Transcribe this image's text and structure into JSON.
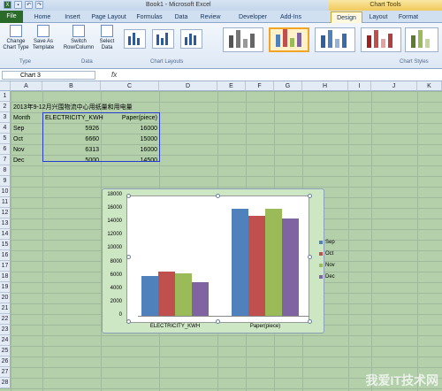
{
  "window": {
    "title": "Book1 - Microsoft Excel",
    "context_tab": "Chart Tools"
  },
  "tabs": [
    "File",
    "Home",
    "Insert",
    "Page Layout",
    "Formulas",
    "Data",
    "Review",
    "Developer",
    "Add-Ins",
    "Design",
    "Layout",
    "Format"
  ],
  "ribbon": {
    "change_chart_type": "Change\nChart Type",
    "save_as_template": "Save As\nTemplate",
    "switch_row_column": "Switch\nRow/Column",
    "select_data": "Select\nData",
    "group_type": "Type",
    "group_data": "Data",
    "group_layouts": "Chart Layouts",
    "group_styles": "Chart Styles"
  },
  "formula_bar": {
    "name_box": "Chart 3",
    "fx": "fx"
  },
  "columns": [
    "A",
    "B",
    "C",
    "D",
    "E",
    "F",
    "G",
    "H",
    "I",
    "J",
    "K"
  ],
  "rows": [
    "1",
    "2",
    "3",
    "4",
    "5",
    "6",
    "7",
    "8",
    "9",
    "10",
    "11",
    "12",
    "13",
    "14",
    "15",
    "16",
    "17",
    "18",
    "19",
    "20",
    "21",
    "22",
    "23",
    "24",
    "25",
    "26",
    "27",
    "28"
  ],
  "sheet": {
    "title": "2013年9-12月兴围物流中心用纸量和用电量",
    "headers": [
      "Month",
      "ELECTRICITY_KWH",
      "Paper(piece)"
    ],
    "data": [
      [
        "Sep",
        "5926",
        "16000"
      ],
      [
        "Oct",
        "6660",
        "15000"
      ],
      [
        "Nov",
        "6313",
        "16000"
      ],
      [
        "Dec",
        "5000",
        "14500"
      ]
    ]
  },
  "chart_data": {
    "type": "bar",
    "categories": [
      "ELECTRICITY_KWH",
      "Paper(piece)"
    ],
    "series": [
      {
        "name": "Sep",
        "values": [
          5926,
          16000
        ],
        "color": "#4f81bd"
      },
      {
        "name": "Oct",
        "values": [
          6660,
          15000
        ],
        "color": "#c0504d"
      },
      {
        "name": "Nov",
        "values": [
          6313,
          16000
        ],
        "color": "#9bbb59"
      },
      {
        "name": "Dec",
        "values": [
          5000,
          14500
        ],
        "color": "#8064a2"
      }
    ],
    "ylim": [
      0,
      18000
    ],
    "yticks": [
      "18000",
      "16000",
      "14000",
      "12000",
      "10000",
      "8000",
      "6000",
      "4000",
      "2000",
      "0"
    ],
    "legend": "right",
    "grid": false
  },
  "watermark": "我爱IT技术网"
}
